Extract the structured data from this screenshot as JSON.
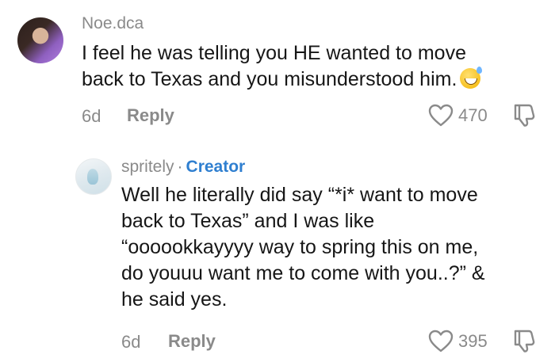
{
  "comments": [
    {
      "username": "Noe.dca",
      "lines": [
        "I feel he was telling you HE wanted to move",
        "back to Texas and you misunderstood him."
      ],
      "time": "6d",
      "reply_label": "Reply",
      "likes": "470",
      "emoji": "grinning-sweat-emoji"
    },
    {
      "username": "spritely",
      "separator": "·",
      "creator_badge": "Creator",
      "lines": [
        "Well he literally did say “*i* want to move",
        "back to Texas” and I was like",
        "“oooookkayyyy way to spring this on me,",
        "do youuu want me to come with you..?” &",
        "he said yes."
      ],
      "time": "6d",
      "reply_label": "Reply",
      "likes": "395"
    }
  ],
  "icons": {
    "like": "heart-outline-icon",
    "dislike": "thumbs-down-outline-icon"
  },
  "colors": {
    "text": "#161616",
    "meta": "#8a8a8a",
    "creator": "#2f7fd0"
  }
}
